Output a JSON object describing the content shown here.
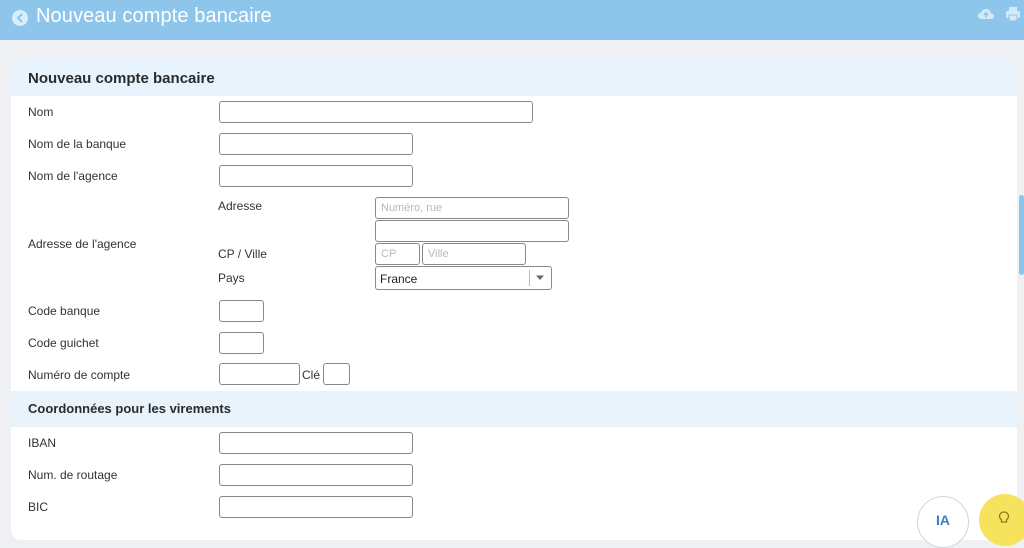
{
  "topbar": {
    "title": "Nouveau compte bancaire"
  },
  "icons": {
    "back": "circle-arrow-left-icon",
    "cloud": "cloud-upload-icon",
    "print": "printer-icon",
    "bulb": "lightbulb-icon"
  },
  "colors": {
    "topbar": "#8ec5ea",
    "section_bg": "#e8f3fc",
    "ia_text": "#3a7fc4",
    "bulb_bg": "#f7e25e"
  },
  "form": {
    "title": "Nouveau compte bancaire",
    "labels": {
      "nom": "Nom",
      "nom_banque": "Nom de la banque",
      "nom_agence": "Nom de l'agence",
      "adresse_agence": "Adresse de l'agence",
      "adresse": "Adresse",
      "cp_ville": "CP / Ville",
      "pays": "Pays",
      "code_banque": "Code banque",
      "code_guichet": "Code guichet",
      "numero_compte": "Numéro de compte",
      "cle": "Clé"
    },
    "placeholders": {
      "adresse1": "Numéro, rue",
      "cp": "CP",
      "ville": "Ville"
    },
    "values": {
      "pays": "France"
    }
  },
  "virements": {
    "title": "Coordonnées pour les virements",
    "labels": {
      "iban": "IBAN",
      "routage": "Num. de routage",
      "bic": "BIC"
    }
  },
  "assistant": {
    "ia_label": "IA"
  }
}
